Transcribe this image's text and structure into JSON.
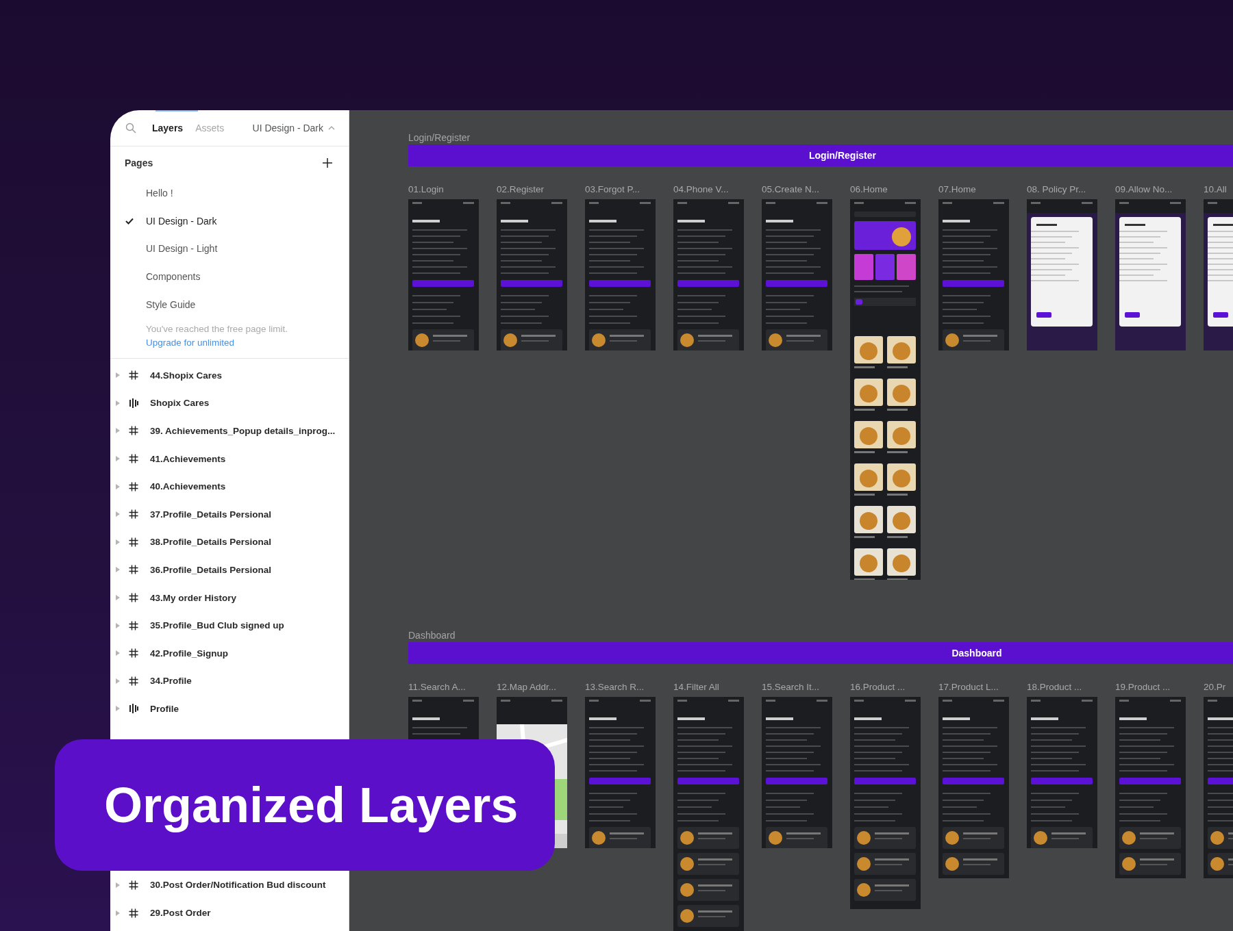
{
  "header": {
    "tabs": [
      {
        "label": "Layers",
        "selected": true
      },
      {
        "label": "Assets",
        "selected": false
      }
    ],
    "page_picker": "UI Design - Dark"
  },
  "pages": {
    "title": "Pages",
    "items": [
      {
        "label": "Hello !",
        "selected": false
      },
      {
        "label": "UI Design - Dark",
        "selected": true
      },
      {
        "label": "UI Design - Light",
        "selected": false
      },
      {
        "label": "Components",
        "selected": false
      },
      {
        "label": "Style Guide",
        "selected": false
      }
    ],
    "limit_note": "You've reached the free page limit.",
    "upgrade_link": "Upgrade for unlimited"
  },
  "layers": [
    {
      "label": "44.Shopix Cares",
      "kind": "frame"
    },
    {
      "label": "Shopix Cares",
      "kind": "section"
    },
    {
      "label": "39. Achievements_Popup details_inprog...",
      "kind": "frame"
    },
    {
      "label": "41.Achievements",
      "kind": "frame"
    },
    {
      "label": "40.Achievements",
      "kind": "frame"
    },
    {
      "label": "37.Profile_Details Persional",
      "kind": "frame"
    },
    {
      "label": "38.Profile_Details Persional",
      "kind": "frame"
    },
    {
      "label": "36.Profile_Details Persional",
      "kind": "frame"
    },
    {
      "label": "43.My order History",
      "kind": "frame"
    },
    {
      "label": "35.Profile_Bud Club signed up",
      "kind": "frame"
    },
    {
      "label": "42.Profile_Signup",
      "kind": "frame"
    },
    {
      "label": "34.Profile",
      "kind": "frame"
    },
    {
      "label": "Profile",
      "kind": "section"
    }
  ],
  "layers_below_banner": [
    {
      "label": "30.Post Order/Notification Bud discount",
      "kind": "frame"
    },
    {
      "label": "29.Post Order",
      "kind": "frame"
    }
  ],
  "canvas": {
    "sections": [
      {
        "label": "Login/Register",
        "banner": "Login/Register",
        "frames": [
          {
            "label": "01.Login",
            "kind": "screen"
          },
          {
            "label": "02.Register",
            "kind": "screen"
          },
          {
            "label": "03.Forgot P...",
            "kind": "screen"
          },
          {
            "label": "04.Phone V...",
            "kind": "screen"
          },
          {
            "label": "05.Create N...",
            "kind": "screen"
          },
          {
            "label": "06.Home",
            "kind": "scroll"
          },
          {
            "label": "07.Home",
            "kind": "screen"
          },
          {
            "label": "08. Policy Pr...",
            "kind": "dialog"
          },
          {
            "label": "09.Allow No...",
            "kind": "dialog"
          },
          {
            "label": "10.All",
            "kind": "dialog"
          }
        ]
      },
      {
        "label": "Dashboard",
        "banner": "Dashboard",
        "frames": [
          {
            "label": "11.Search A...",
            "kind": "screen"
          },
          {
            "label": "12.Map Addr...",
            "kind": "map"
          },
          {
            "label": "13.Search R...",
            "kind": "screen"
          },
          {
            "label": "14.Filter All",
            "kind": "full"
          },
          {
            "label": "15.Search It...",
            "kind": "screen"
          },
          {
            "label": "16.Product ...",
            "kind": "long"
          },
          {
            "label": "17.Product L...",
            "kind": "tall"
          },
          {
            "label": "18.Product ...",
            "kind": "screen"
          },
          {
            "label": "19.Product ...",
            "kind": "tall"
          },
          {
            "label": "20.Pr",
            "kind": "tall"
          }
        ]
      }
    ]
  },
  "banner": {
    "text": "Organized Layers"
  }
}
